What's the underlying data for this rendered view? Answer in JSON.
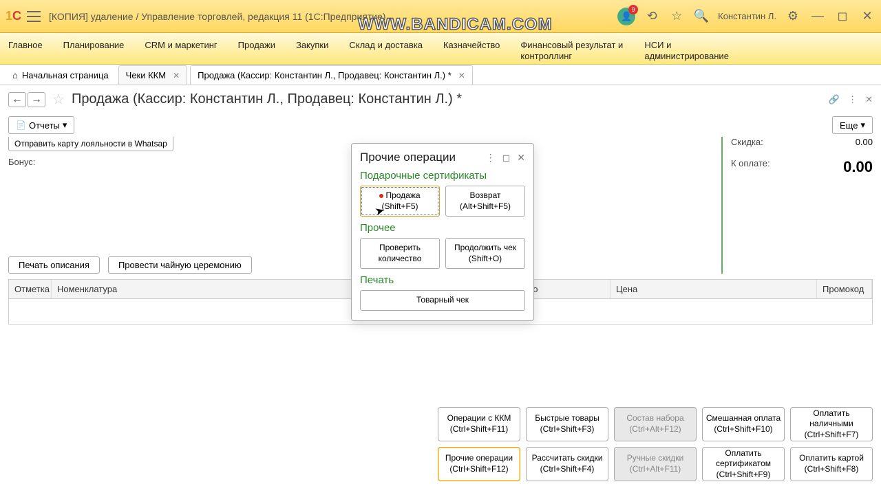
{
  "titlebar": {
    "title": "[КОПИЯ] удаление / Управление торговлей, редакция 11  (1С:Предприятие)",
    "watermark": "WWW.BANDICAM.COM",
    "badge_count": "9",
    "username": "Константин Л."
  },
  "nav": {
    "items": [
      "Главное",
      "Планирование",
      "CRM и маркетинг",
      "Продажи",
      "Закупки",
      "Склад и доставка",
      "Казначейство",
      "Финансовый результат и контроллинг",
      "НСИ и администрирование"
    ]
  },
  "tabs": {
    "home": "Начальная страница",
    "items": [
      {
        "label": "Чеки ККМ"
      },
      {
        "label": "Продажа (Кассир: Константин Л., Продавец: Константин Л.) *"
      }
    ]
  },
  "page": {
    "title": "Продажа (Кассир: Константин Л., Продавец: Константин Л.) *",
    "reports_btn": "Отчеты",
    "more_btn": "Еще",
    "whatsapp_btn": "Отправить карту лояльности в Whatsap",
    "bonus_label": "Бонус:",
    "print_desc": "Печать описания",
    "tea_ceremony": "Провести чайную церемонию"
  },
  "summary": {
    "discount_label": "Скидка:",
    "discount_val": "0.00",
    "to_pay_label": "К оплате:",
    "to_pay_val": "0.00"
  },
  "table": {
    "cols": [
      "Отметка",
      "Номенклатура",
      "ство",
      "Цена",
      "Промокод"
    ]
  },
  "dialog": {
    "title": "Прочие операции",
    "section1": "Подарочные сертификаты",
    "btn_sale": "Продажа (Shift+F5)",
    "btn_return": "Возврат (Alt+Shift+F5)",
    "section2": "Прочее",
    "btn_check_qty": "Проверить количество",
    "btn_continue": "Продолжить чек (Shift+O)",
    "section3": "Печать",
    "btn_receipt": "Товарный чек"
  },
  "bottom": {
    "row1": [
      {
        "label": "Операции с ККМ (Ctrl+Shift+F11)",
        "state": ""
      },
      {
        "label": "Быстрые товары (Ctrl+Shift+F3)",
        "state": ""
      },
      {
        "label": "Состав набора (Ctrl+Alt+F12)",
        "state": "disabled"
      },
      {
        "label": "Смешанная оплата (Ctrl+Shift+F10)",
        "state": ""
      },
      {
        "label": "Оплатить наличными (Ctrl+Shift+F7)",
        "state": ""
      }
    ],
    "row2": [
      {
        "label": "Прочие операции (Ctrl+Shift+F12)",
        "state": "active"
      },
      {
        "label": "Рассчитать скидки (Ctrl+Shift+F4)",
        "state": ""
      },
      {
        "label": "Ручные скидки (Ctrl+Alt+F11)",
        "state": "disabled"
      },
      {
        "label": "Оплатить сертификатом (Ctrl+Shift+F9)",
        "state": ""
      },
      {
        "label": "Оплатить картой (Ctrl+Shift+F8)",
        "state": ""
      }
    ]
  }
}
